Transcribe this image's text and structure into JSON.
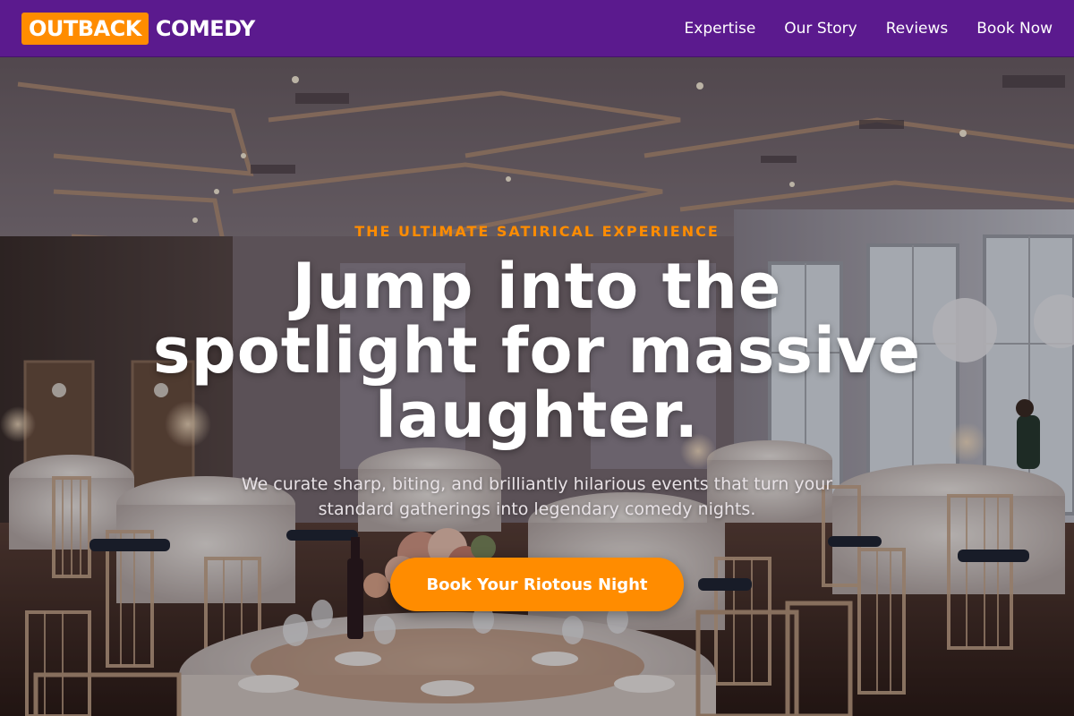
{
  "brand": {
    "logo_box": "OUTBACK",
    "logo_text": "COMEDY"
  },
  "nav": {
    "items": [
      {
        "label": "Expertise"
      },
      {
        "label": "Our Story"
      },
      {
        "label": "Reviews"
      },
      {
        "label": "Book Now"
      }
    ]
  },
  "hero": {
    "eyebrow": "THE ULTIMATE SATIRICAL EXPERIENCE",
    "headline": "Jump into the spotlight for massive laughter.",
    "subtext": "We curate sharp, biting, and brilliantly hilarious events that turn your standard gatherings into legendary comedy nights.",
    "cta_label": "Book Your Riotous Night",
    "background_image": "banquet-hall-photo"
  },
  "colors": {
    "navbar": "#5b1a8e",
    "accent": "#ff8c00",
    "text": "#ffffff"
  }
}
